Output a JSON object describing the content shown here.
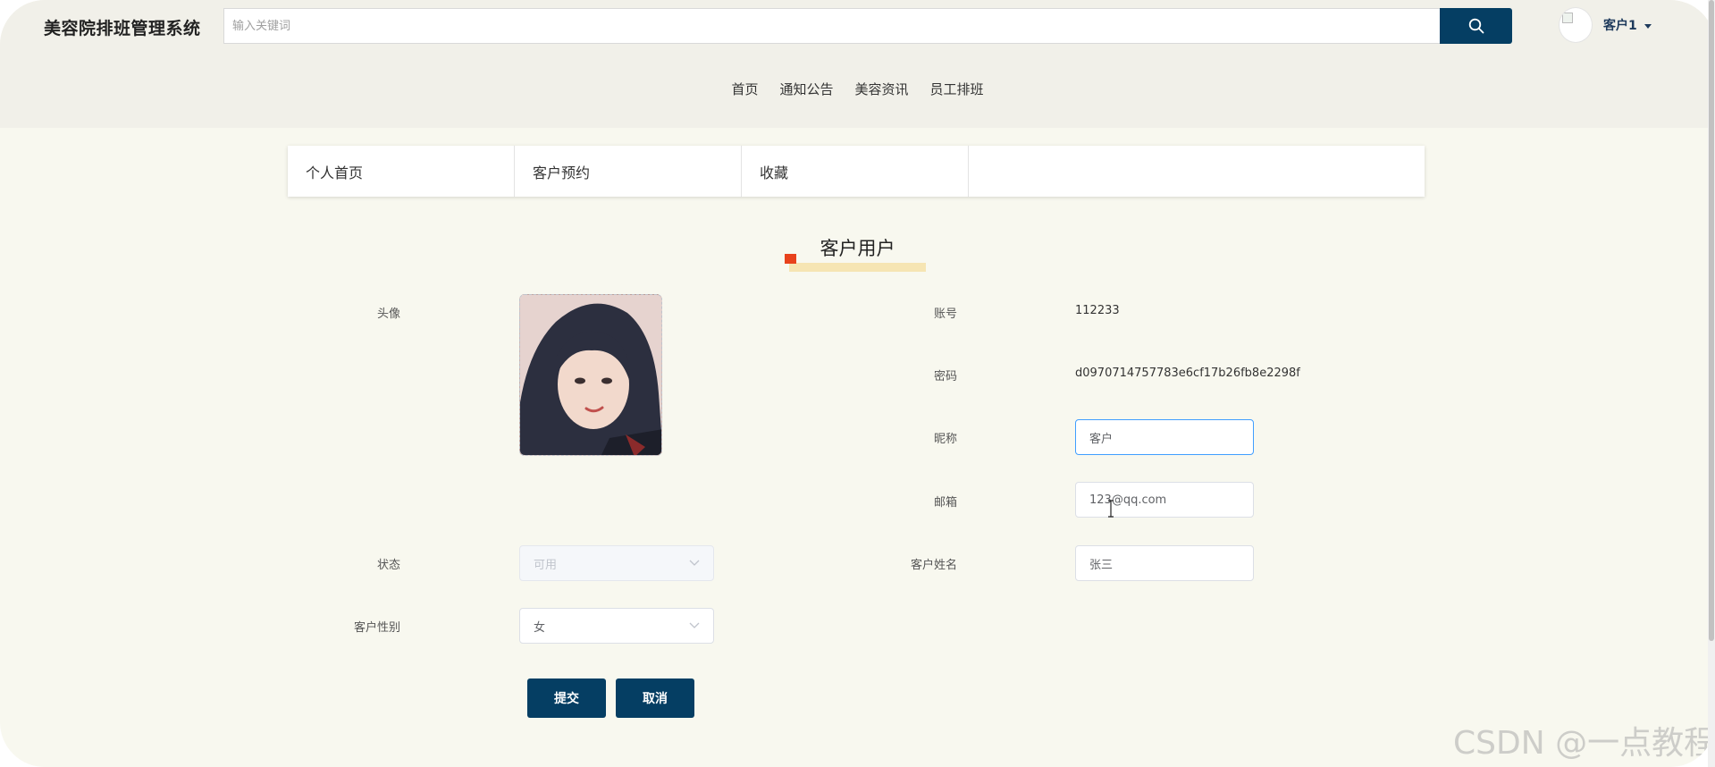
{
  "app": {
    "title": "美容院排班管理系统"
  },
  "search": {
    "placeholder": "输入关键词",
    "button_icon": "search-icon"
  },
  "user": {
    "name": "客户1",
    "avatar_icon": "broken-image-icon"
  },
  "nav": {
    "items": [
      "首页",
      "通知公告",
      "美容资讯",
      "员工排班"
    ]
  },
  "subtabs": {
    "items": [
      "个人首页",
      "客户预约",
      "收藏"
    ]
  },
  "section": {
    "title": "客户用户"
  },
  "form": {
    "avatar_label": "头像",
    "account_label": "账号",
    "account_value": "112233",
    "password_label": "密码",
    "password_value": "d0970714757783e6cf17b26fb8e2298f",
    "nickname_label": "昵称",
    "nickname_value": "客户",
    "email_label": "邮箱",
    "email_value": "123@qq.com",
    "status_label": "状态",
    "status_value": "可用",
    "customer_name_label": "客户姓名",
    "customer_name_value": "张三",
    "gender_label": "客户性别",
    "gender_value": "女"
  },
  "buttons": {
    "submit": "提交",
    "cancel": "取消"
  },
  "watermark": "CSDN @一点教程",
  "colors": {
    "primary": "#053e63",
    "accent": "#e8421c",
    "highlight": "#f6e5b3",
    "focus": "#409eff"
  }
}
